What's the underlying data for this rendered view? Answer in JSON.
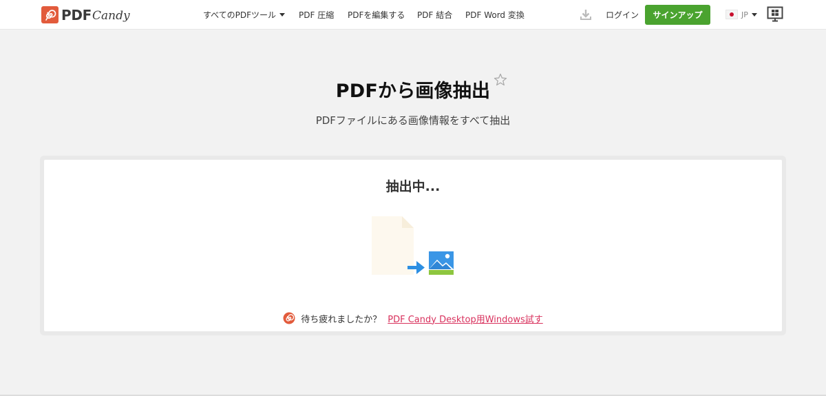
{
  "brand": {
    "name_bold": "PDF",
    "name_script": "Candy",
    "accent_color": "#e25b3c"
  },
  "nav": {
    "all_tools": "すべてのPDFツール",
    "compress": "PDF 圧縮",
    "edit": "PDFを編集する",
    "merge": "PDF 結合",
    "to_word": "PDF Word 変換"
  },
  "header_actions": {
    "download_icon": "download-icon",
    "login": "ログイン",
    "signup": "サインアップ",
    "signup_color": "#4aa32f",
    "language": "JP",
    "desktop_icon": "windows-desktop-icon"
  },
  "hero": {
    "title": "PDFから画像抽出",
    "subtitle": "PDFファイルにある画像情報をすべて抽出",
    "favorite_icon": "star-outline-icon"
  },
  "progress": {
    "status": "抽出中..."
  },
  "promo": {
    "text": "待ち疲れましたか？",
    "link": "PDF Candy Desktop用Windows試す",
    "link_color": "#d8305c"
  }
}
